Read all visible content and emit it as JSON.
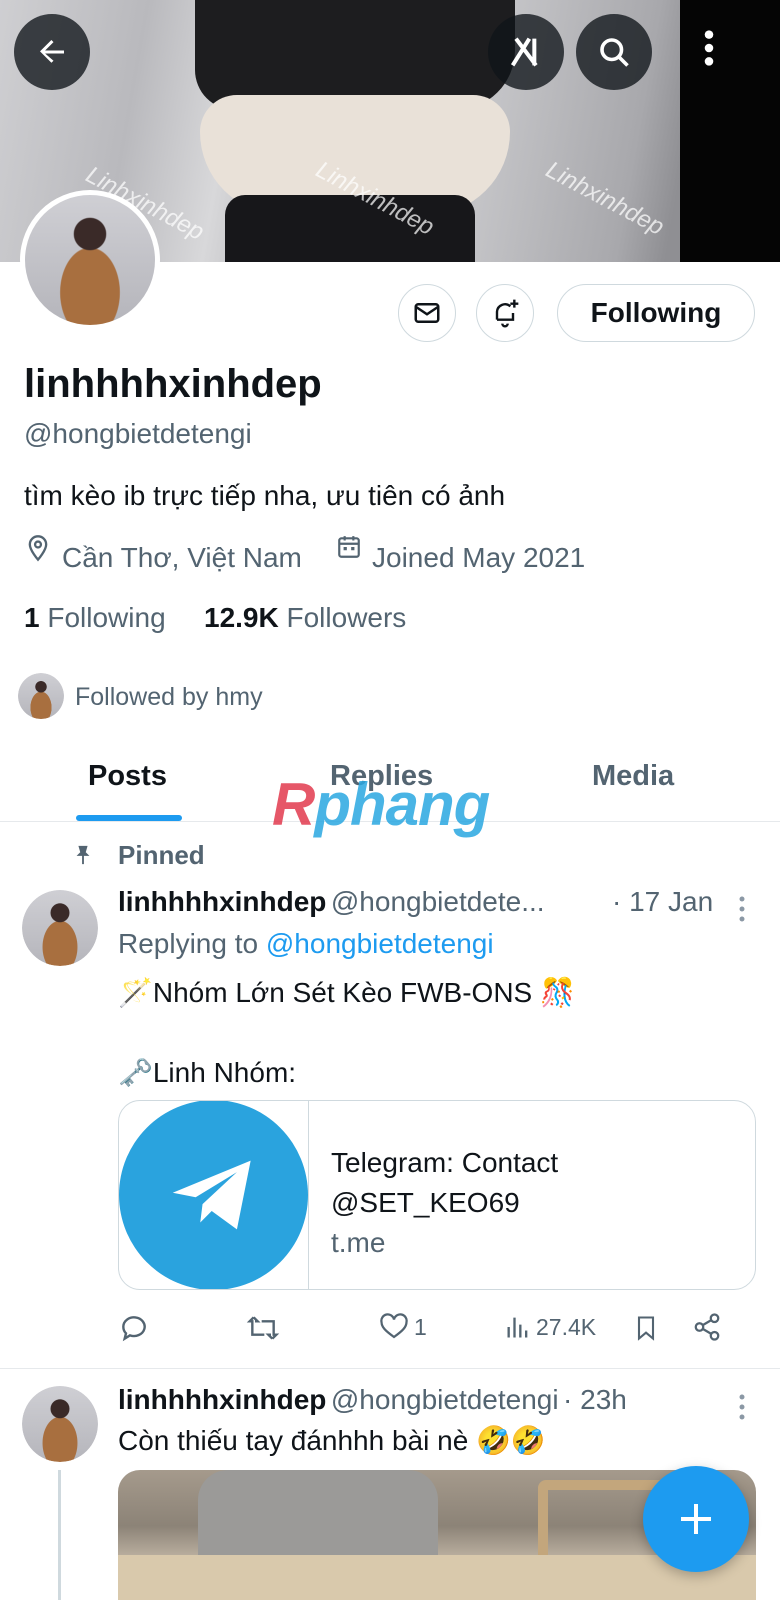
{
  "banner": {
    "watermarks": [
      "Linhxinhdep",
      "Linhxinhdep",
      "Linhxinhdep"
    ]
  },
  "header": {
    "back_icon": "arrow-left-icon",
    "grok_icon": "grok-icon",
    "search_icon": "search-icon",
    "more_icon": "more-vertical-icon"
  },
  "profile": {
    "display_name": "linhhhhxinhdep",
    "handle": "@hongbietdetengi",
    "bio": "tìm kèo ib trực tiếp nha, ưu tiên có ảnh",
    "location": "Cần Thơ, Việt Nam",
    "joined": "Joined May 2021",
    "following_count": "1",
    "following_label": "Following",
    "followers_count": "12.9K",
    "followers_label": "Followers",
    "followed_by": "Followed by hmy",
    "follow_button_label": "Following"
  },
  "tabs": [
    {
      "label": "Posts",
      "active": true
    },
    {
      "label": "Replies",
      "active": false
    },
    {
      "label": "Media",
      "active": false
    }
  ],
  "watermark": {
    "r": "R",
    "rest": "phang"
  },
  "posts": [
    {
      "pinned_label": "Pinned",
      "name": "linhhhhxinhdep",
      "handle": "@hongbietdete...",
      "time": "· 17 Jan",
      "replying_prefix": "Replying to ",
      "replying_to": "@hongbietdetengi",
      "line1": "🪄Nhóm Lớn Sét Kèo FWB-ONS 🎊",
      "line2": "🗝️Linh Nhóm:",
      "card_title": "Telegram: Contact @SET_KEO69",
      "card_domain": "t.me",
      "actions": {
        "reply": "",
        "repost": "",
        "like": "1",
        "views": "27.4K"
      }
    },
    {
      "name": "linhhhhxinhdep",
      "handle": "@hongbietdetengi",
      "time": "· 23h",
      "text": "Còn thiếu tay đánhhh bài nè 🤣🤣"
    }
  ],
  "colors": {
    "accent": "#1d9bf0",
    "text": "#0f1419",
    "secondary": "#536471",
    "border": "#cfd9de",
    "telegram": "#2aa3de"
  }
}
